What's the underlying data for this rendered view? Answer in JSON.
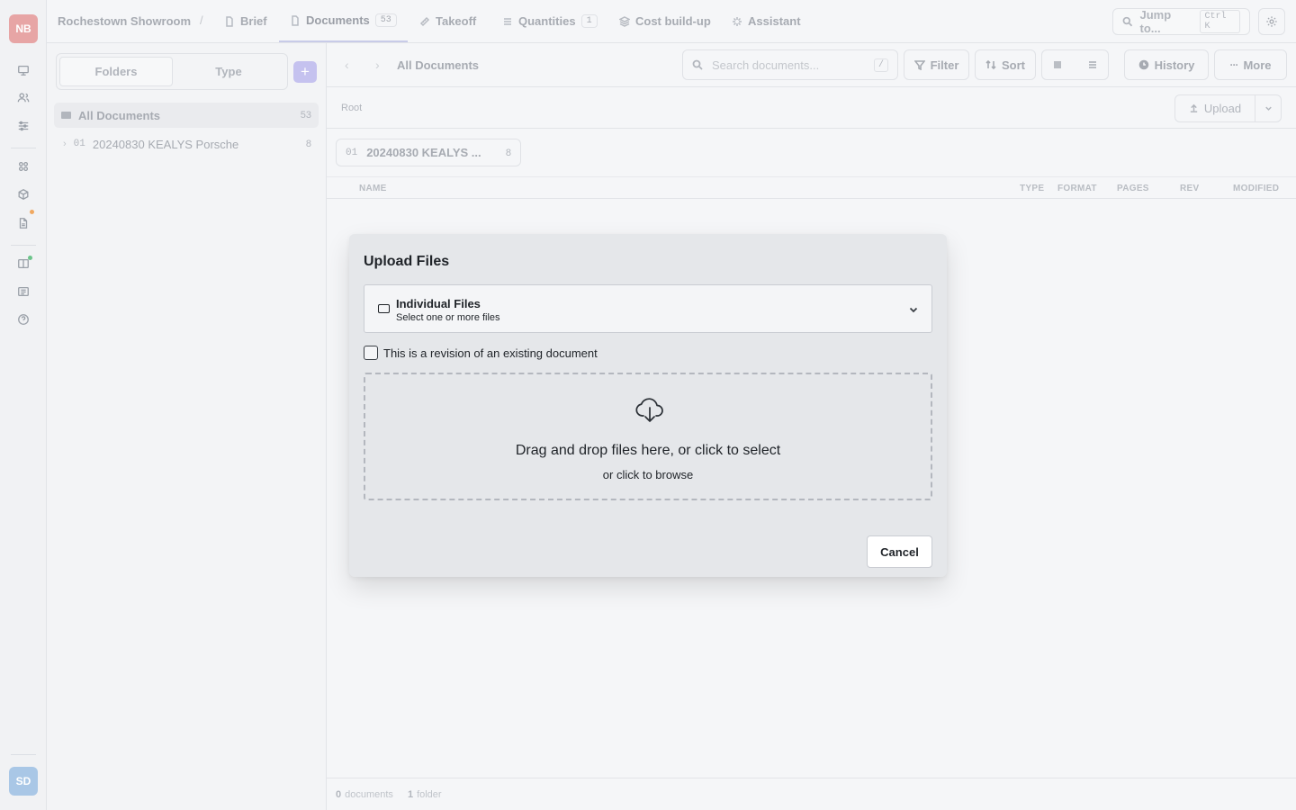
{
  "rail": {
    "user_initials_top": "NB",
    "user_initials_bottom": "SD",
    "icons": [
      "monitor-icon",
      "users-icon",
      "sliders-icon",
      "grid-icon",
      "box-icon",
      "file-icon",
      "book-icon",
      "list-icon",
      "help-icon"
    ]
  },
  "topbar": {
    "project": "Rochestown Showroom",
    "separator": "/",
    "tabs": [
      {
        "label": "Brief",
        "icon": "file-icon"
      },
      {
        "label": "Documents",
        "icon": "document-icon",
        "count": "53",
        "active": true
      },
      {
        "label": "Takeoff",
        "icon": "ruler-icon"
      },
      {
        "label": "Quantities",
        "icon": "list-icon",
        "count": "1"
      },
      {
        "label": "Cost build-up",
        "icon": "layers-icon"
      },
      {
        "label": "Assistant",
        "icon": "sparkle-icon"
      }
    ],
    "jump_label": "Jump to...",
    "jump_kbd": "Ctrl K"
  },
  "left_panel": {
    "seg_folders": "Folders",
    "seg_type": "Type",
    "add_label": "+",
    "all_documents": {
      "label": "All Documents",
      "count": "53"
    },
    "folder": {
      "num": "01",
      "label": "20240830 KEALYS Porsche",
      "count": "8",
      "chevron": "›"
    }
  },
  "main": {
    "nav_back": "‹",
    "nav_forward": "›",
    "breadcrumb": "All Documents",
    "search_placeholder": "Search documents...",
    "search_kbd": "/",
    "filter_label": "Filter",
    "sort_label": "Sort",
    "history_label": "History",
    "more_label": "More",
    "root_label": "Root",
    "upload_label": "Upload",
    "chip": {
      "num": "01",
      "label": "20240830 KEALYS ...",
      "count": "8"
    },
    "columns": [
      "NAME",
      "TYPE",
      "FORMAT",
      "PAGES",
      "REV",
      "MODIFIED"
    ],
    "status": {
      "docs_count": "0",
      "docs_label": "documents",
      "folders_count": "1",
      "folders_label": "folder"
    }
  },
  "modal": {
    "title": "Upload Files",
    "mode_title": "Individual Files",
    "mode_subtitle": "Select one or more files",
    "revision_label": "This is a revision of an existing document",
    "drop_heading": "Drag and drop files here, or click to select",
    "drop_sub": "or click to browse",
    "cancel_label": "Cancel"
  },
  "colors": {
    "accent": "#c5c2ef",
    "avatar_top": "#e7a5a5",
    "avatar_bottom": "#a9c7e6",
    "notify_orange": "#f0a860",
    "notify_green": "#6cc48a"
  }
}
